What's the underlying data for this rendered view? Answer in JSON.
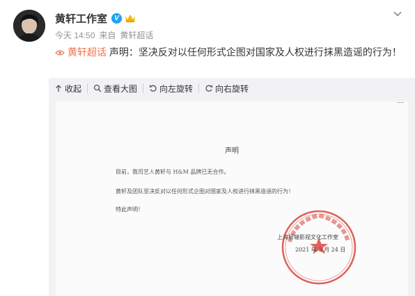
{
  "post": {
    "author": "黄轩工作室",
    "time": "今天 14:50",
    "source_prefix": "来自",
    "source": "黄轩超话",
    "topic": "黄轩超话",
    "text": "声明：坚决反对以任何形式企图对国家及人权进行抹黑造谣的行为！"
  },
  "toolbar": {
    "collapse": "收起",
    "view_large": "查看大图",
    "rotate_left": "向左旋转",
    "rotate_right": "向右旋转"
  },
  "document": {
    "title": "声明",
    "line1": "目前，我司艺人黄轩与 H&M 品牌已无合作。",
    "line2": "黄轩及团队坚决反对以任何形式企图对国家及人权进行抹黑造谣的行为！",
    "line3": "特此声明！",
    "signer": "上海轩辕影视文化工作室",
    "date": "2021 年 3 月 24 日"
  },
  "icons": {
    "verified": "verified-v-icon",
    "crown": "vip-crown-icon",
    "chevron": "chevron-down-icon",
    "topic": "super-topic-eye-icon",
    "collapse": "collapse-arrow-icon",
    "view_large": "magnifier-icon",
    "rotate_left": "rotate-left-icon",
    "rotate_right": "rotate-right-icon"
  },
  "colors": {
    "topic": "#eb7350",
    "verified": "#1da1f2",
    "seal": "#d9453c"
  }
}
